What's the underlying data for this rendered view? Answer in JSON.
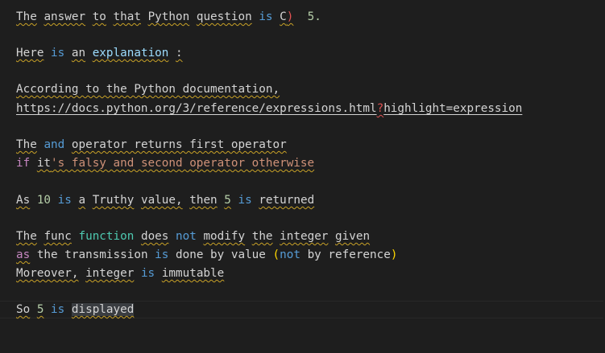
{
  "lines": {
    "l1": {
      "w1": "The",
      "w2": "answer",
      "w3": "to",
      "w4": "that",
      "w5": "Python",
      "w6": "question",
      "kw_is": "is",
      "opt": "C",
      "paren": ")",
      "num": "5."
    },
    "l2": {
      "w1": "Here",
      "kw_is": "is",
      "w2": "an",
      "w3": "explanation",
      "colon": ":"
    },
    "l3": {
      "text": "According to the Python documentation,"
    },
    "l4": {
      "url_a": "https://docs.python.org/3/reference/expressions.html",
      "q": "?",
      "url_b": "highlight=expression"
    },
    "l5": {
      "w1": "The",
      "kw_and": "and",
      "rest": "operator returns first operator"
    },
    "l6": {
      "kw_if": "if",
      "w1": "it",
      "str": "'s falsy and second operator otherwise"
    },
    "l7": {
      "w1": "As",
      "num1": "10",
      "kw_is1": "is",
      "w2": "a",
      "w3": "Truthy",
      "w4": "value,",
      "w5": "then",
      "num2": "5",
      "kw_is2": "is",
      "w6": "returned"
    },
    "l8": {
      "w1": "The",
      "w2": "func",
      "fn": "function",
      "w3": "does",
      "kw_not": "not",
      "w4": "modify",
      "w5": "the",
      "w6": "integer",
      "w7": "given"
    },
    "l9": {
      "kw_as": "as",
      "w1": "the transmission",
      "kw_is": "is",
      "w2": "done by value",
      "po": "(",
      "kw_not": "not",
      "w3": "by reference",
      "pc": ")"
    },
    "l10": {
      "w1": "Moreover,",
      "w2": "integer",
      "kw_is": "is",
      "w3": "immutable"
    },
    "l11": {
      "w1": "So",
      "num": "5",
      "kw_is": "is",
      "w2": "displayed"
    }
  }
}
